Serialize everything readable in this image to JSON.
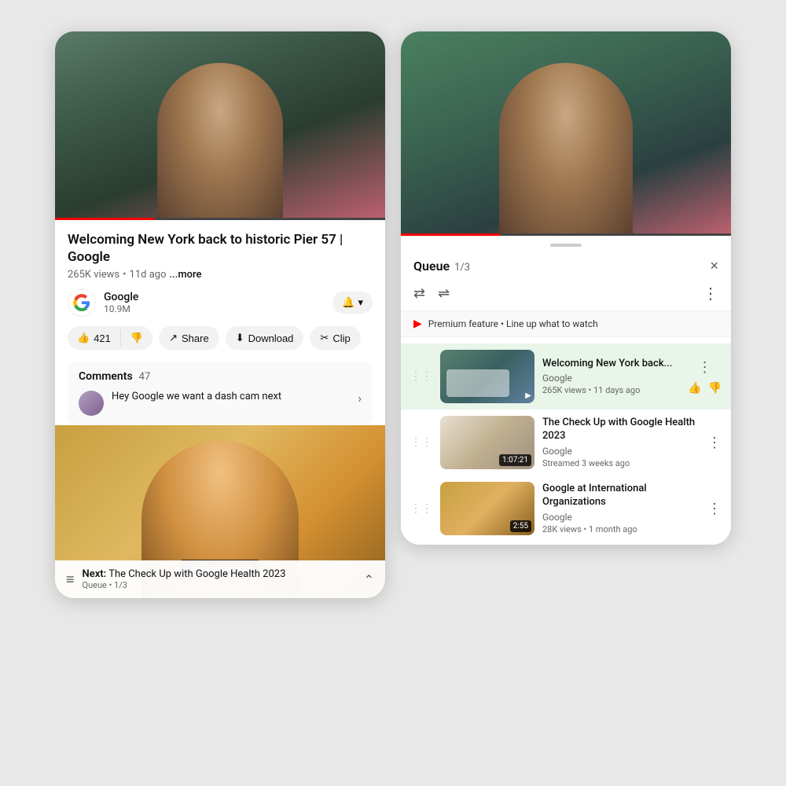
{
  "left_phone": {
    "video": {
      "title": "Welcoming New York back to historic Pier 57 | Google",
      "views": "265K views",
      "time_ago": "11d ago",
      "more_label": "...more"
    },
    "channel": {
      "name": "Google",
      "subscribers": "10.9M"
    },
    "actions": {
      "like_count": "421",
      "like_label": "421",
      "dislike_label": "",
      "share_label": "Share",
      "download_label": "Download",
      "clip_label": "Clip"
    },
    "comments": {
      "label": "Comments",
      "count": "47",
      "first_comment": "Hey Google we want a dash cam next",
      "expand_icon": "›"
    },
    "next_video": {
      "label": "Next:",
      "title": "The Check Up with Google Health 2023",
      "queue_label": "Queue",
      "queue_position": "1/3"
    }
  },
  "right_phone": {
    "queue": {
      "title": "Queue",
      "position": "1/3",
      "close_icon": "×",
      "loop_icon": "⇄",
      "shuffle_icon": "⇌",
      "more_icon": "⋮"
    },
    "premium": {
      "text": "Premium feature • Line up what to watch"
    },
    "items": [
      {
        "title": "Welcoming New York back...",
        "channel": "Google",
        "meta": "265K views • 11 days ago",
        "active": true,
        "more_icon": "⋮"
      },
      {
        "title": "The Check Up with Google Health 2023",
        "channel": "Google",
        "meta": "Streamed 3 weeks ago",
        "duration": "1:07:21",
        "active": false,
        "more_icon": "⋮"
      },
      {
        "title": "Google at International Organizations",
        "channel": "Google",
        "meta": "28K views • 1 month ago",
        "duration": "2:55",
        "active": false,
        "more_icon": "⋮"
      }
    ]
  }
}
